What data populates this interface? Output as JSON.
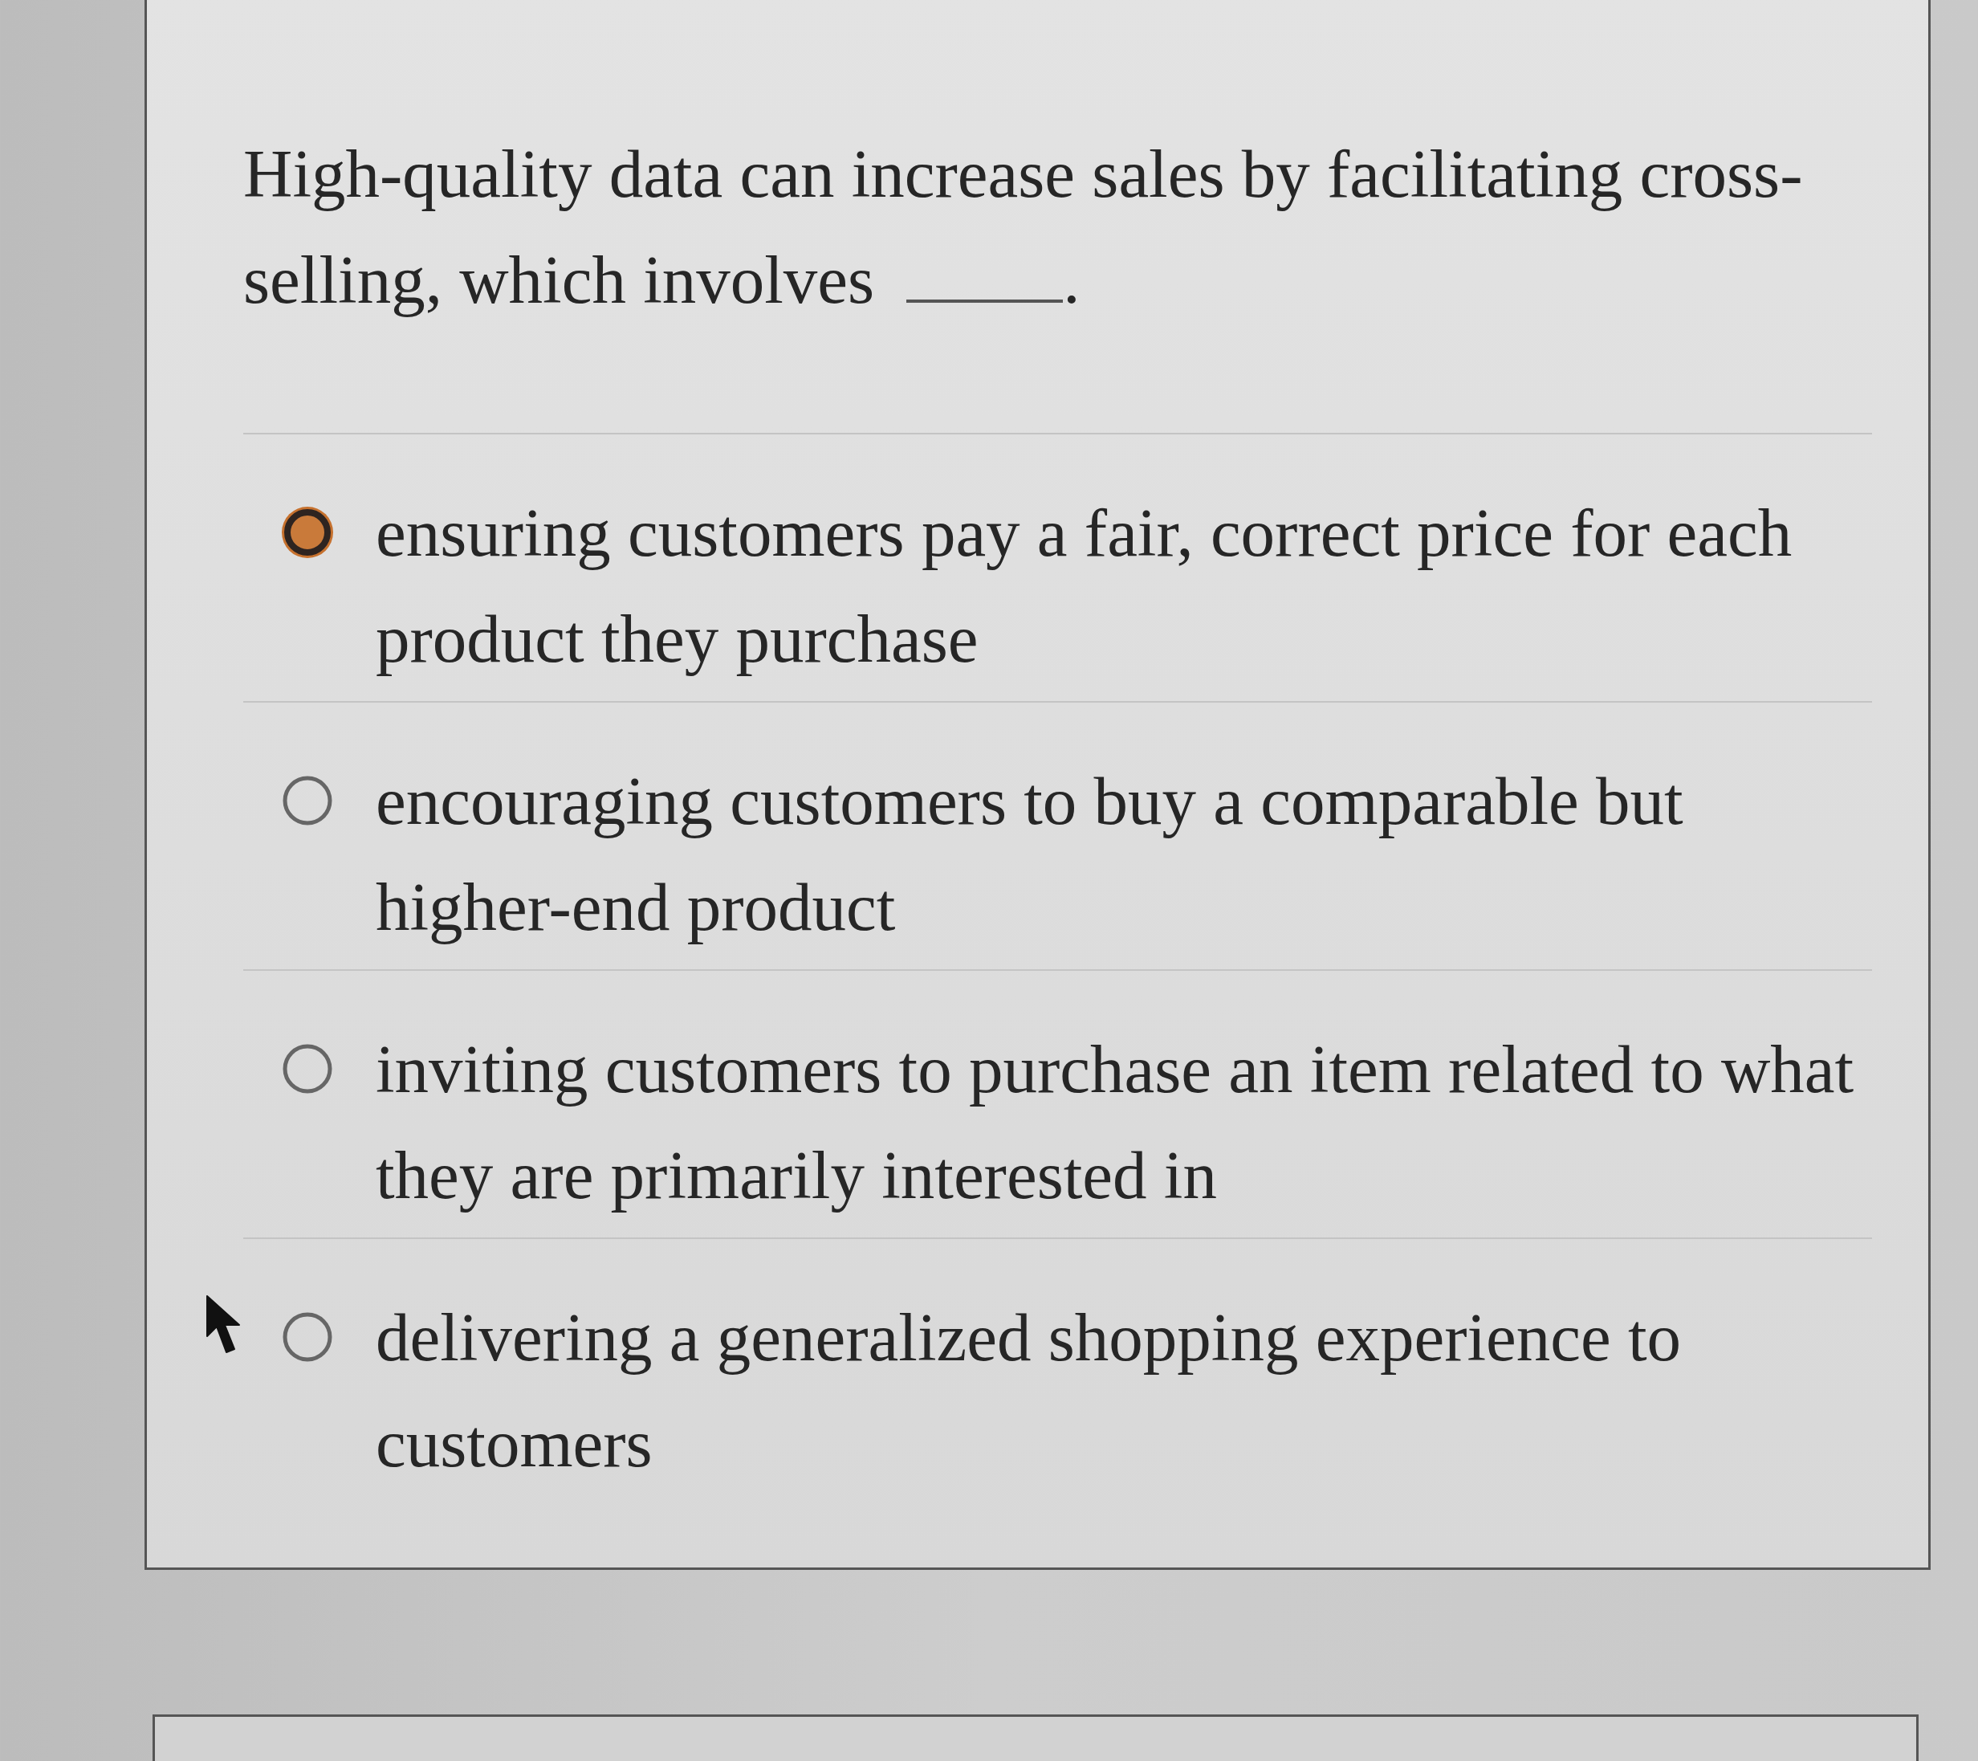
{
  "question": {
    "lines": [
      "High-quality data can increase sales by facilitating cross-",
      "selling, which involves"
    ],
    "after_blank": "."
  },
  "options": [
    {
      "text": "ensuring customers pay a fair, correct price for each product they purchase",
      "selected": true
    },
    {
      "text": "encouraging customers to buy a comparable but higher-end product",
      "selected": false
    },
    {
      "text": "inviting customers to purchase an item related to what they are primarily interested in",
      "selected": false
    },
    {
      "text": "delivering a generalized shopping experience to customers",
      "selected": false
    }
  ]
}
